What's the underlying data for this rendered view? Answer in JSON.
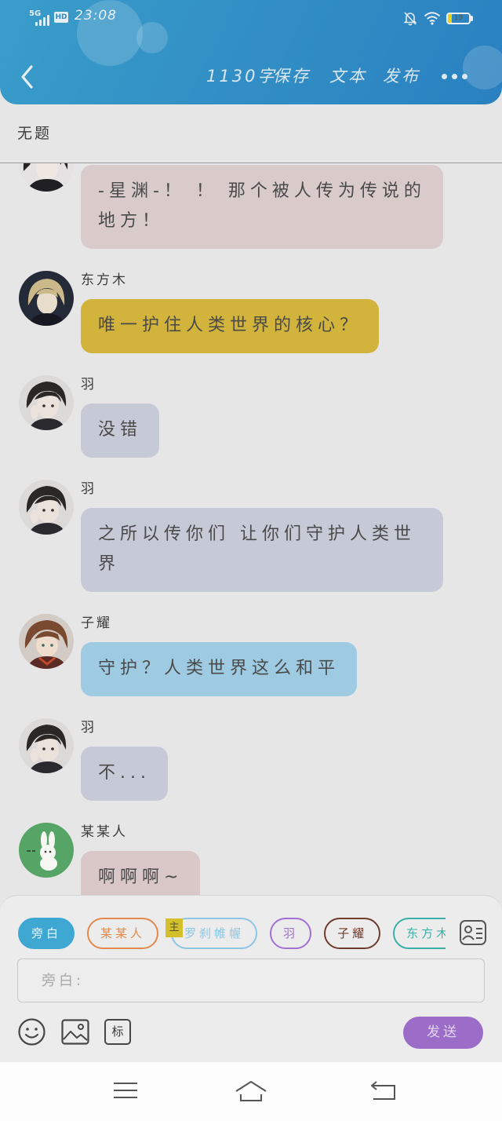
{
  "status_bar": {
    "network": "5G",
    "hd_badge": "HD",
    "time": "23:08",
    "battery_level": "19"
  },
  "header": {
    "word_count": "1130字",
    "save_label": "保存",
    "text_label": "文本",
    "publish_label": "发布"
  },
  "story": {
    "title": "无题"
  },
  "messages": [
    {
      "text": "-星渊-！ ！ 那个被人传为传说的地方！",
      "bubble_color": "#d8cbca",
      "avatar": "dark-hair-avatar"
    },
    {
      "speaker": "东方木",
      "text": "唯一护住人类世界的核心？",
      "bubble_color": "#d2b33b",
      "avatar": "blonde-hair-avatar"
    },
    {
      "speaker": "羽",
      "text": "没错",
      "bubble_color": "#c6cad6",
      "avatar": "black-hair-avatar"
    },
    {
      "speaker": "羽",
      "text": "之所以传你们 让你们守护人类世界",
      "bubble_color": "#c6cad6",
      "avatar": "black-hair-avatar"
    },
    {
      "speaker": "子耀",
      "text": "守护？人类世界这么和平",
      "bubble_color": "#9ecbe2",
      "avatar": "brown-hair-avatar"
    },
    {
      "speaker": "羽",
      "text": "不...",
      "bubble_color": "#c6cad6",
      "avatar": "black-hair-avatar"
    },
    {
      "speaker": "某某人",
      "text": "啊啊啊~",
      "bubble_color": "#dac7c7",
      "avatar": "rabbit-avatar"
    }
  ],
  "characters": [
    {
      "label": "旁白",
      "color": "#3ea8d3",
      "selected": true
    },
    {
      "label": "某某人",
      "color": "#e08a4e",
      "selected": false
    },
    {
      "label": "罗刹帷幄",
      "color": "#8dc6e4",
      "selected": false,
      "badge": "主"
    },
    {
      "label": "羽",
      "color": "#a26fd4",
      "selected": false
    },
    {
      "label": "子耀",
      "color": "#6e3b2c",
      "selected": false
    },
    {
      "label": "东方木",
      "color": "#3bb0a8",
      "selected": false
    }
  ],
  "composer": {
    "placeholder": "旁白:",
    "tag_label": "标",
    "send_label": "发送"
  },
  "theme": {
    "header_start": "#3a9dca",
    "header_end": "#2a80c0",
    "send_button": "#9b6dc9"
  }
}
